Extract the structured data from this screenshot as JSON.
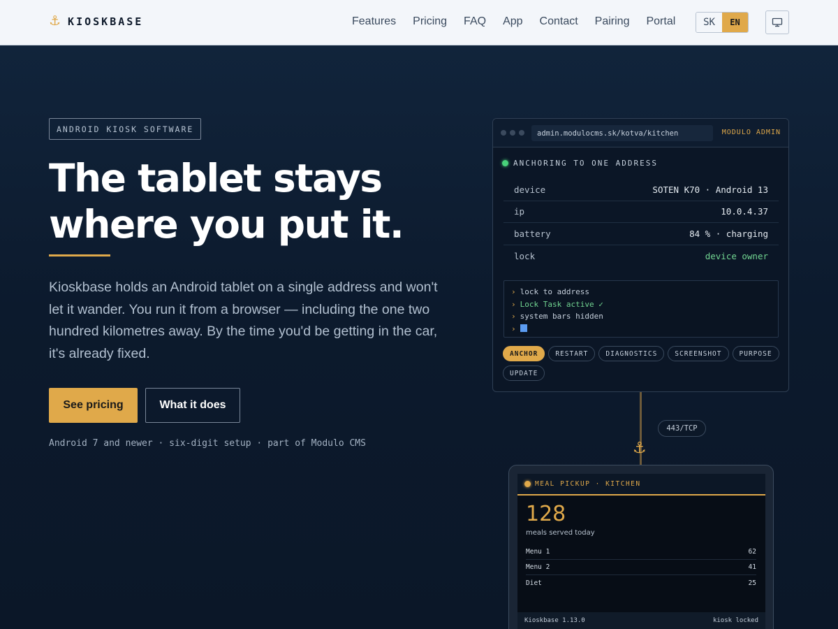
{
  "brand": {
    "name": "KIOSKBASE",
    "logo_icon": "anchor-icon",
    "accent": "#e0a94a"
  },
  "nav": {
    "items": [
      "Features",
      "Pricing",
      "FAQ",
      "App",
      "Contact",
      "Pairing",
      "Portal"
    ],
    "lang": {
      "sk": "SK",
      "en": "EN",
      "selected": "EN"
    },
    "screen_icon": "monitor-icon"
  },
  "hero": {
    "badge": "ANDROID KIOSK SOFTWARE",
    "headline_line1": "The tablet stays",
    "headline_line2": "where you put it.",
    "lead": "Kioskbase holds an Android tablet on a single address and won't let it wander. You run it from a browser — including the one two hundred kilometres away. By the time you'd be getting in the car, it's already fixed.",
    "cta_primary": "See pricing",
    "cta_secondary": "What it does",
    "subnote": "Android 7 and newer · six-digit setup · part of Modulo CMS"
  },
  "admin": {
    "url": "admin.modulocms.sk/kotva/kitchen",
    "tag": "MODULO ADMIN",
    "status": "ANCHORING TO ONE ADDRESS",
    "rows": [
      {
        "k": "device",
        "v": "SOTEN K70 · Android 13"
      },
      {
        "k": "ip",
        "v": "10.0.4.37"
      },
      {
        "k": "battery",
        "v": "84 % · charging"
      },
      {
        "k": "lock",
        "v": "device owner"
      }
    ],
    "console": [
      "lock to address",
      "Lock Task active ✓",
      "system bars hidden"
    ],
    "console_prompt": "›",
    "chips": [
      "ANCHOR",
      "RESTART",
      "DIAGNOSTICS",
      "SCREENSHOT",
      "PURPOSE",
      "UPDATE"
    ],
    "active_chip": "ANCHOR"
  },
  "connector": {
    "port": "443/TCP"
  },
  "tablet": {
    "header": "MEAL PICKUP · KITCHEN",
    "count": "128",
    "count_caption": "meals served today",
    "rows": [
      {
        "name": "Menu 1",
        "value": "62"
      },
      {
        "name": "Menu 2",
        "value": "41"
      },
      {
        "name": "Diet",
        "value": "25"
      }
    ],
    "footer_left": "Kioskbase 1.13.0",
    "footer_right": "kiosk locked"
  }
}
